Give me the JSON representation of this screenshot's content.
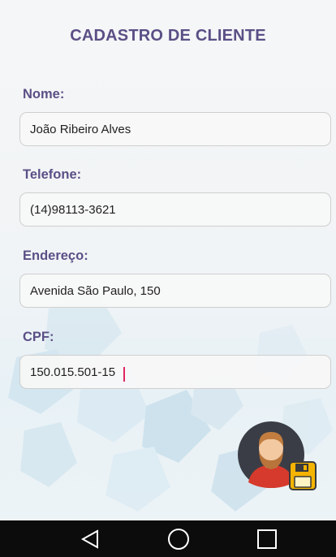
{
  "title": "CADASTRO DE CLIENTE",
  "fields": [
    {
      "label": "Nome:",
      "value": "João Ribeiro Alves"
    },
    {
      "label": "Telefone:",
      "value": "(14)98113-3621"
    },
    {
      "label": "Endereço:",
      "value": "Avenida São Paulo, 150"
    },
    {
      "label": "CPF:",
      "value": "150.015.501-15"
    }
  ],
  "fab": {
    "icons": [
      "user-avatar-icon",
      "save-floppy-icon"
    ]
  },
  "navbar": {
    "icons": [
      "back-triangle-icon",
      "home-circle-icon",
      "recents-square-icon"
    ]
  },
  "colors": {
    "title": "#5b4f86",
    "cursor": "#e0245e",
    "navbar": "#0c0c0c",
    "floppy": "#f5b400"
  }
}
